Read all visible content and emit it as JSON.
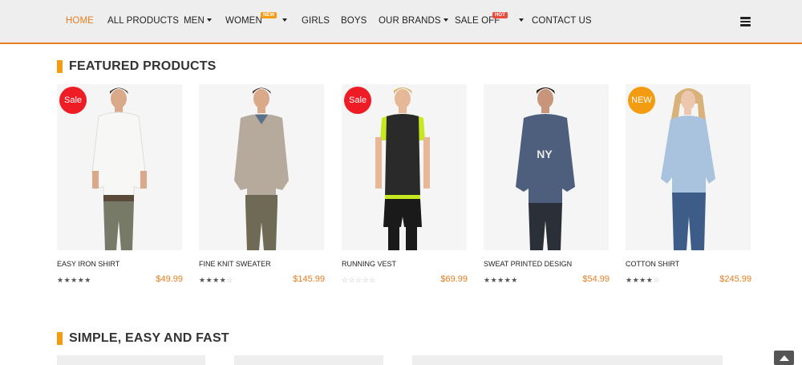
{
  "nav": {
    "items": [
      {
        "label": "HOME"
      },
      {
        "label": "ALL PRODUCTS"
      },
      {
        "label": "MEN"
      },
      {
        "label": "WOMEN",
        "tag": "NEW"
      },
      {
        "label": "GIRLS"
      },
      {
        "label": "BOYS"
      },
      {
        "label": "OUR BRANDS"
      },
      {
        "label": "SALE OFF",
        "tag": "HOT"
      },
      {
        "label": "CONTACT US"
      }
    ],
    "accent_color": "#e67e22"
  },
  "featured": {
    "title": "FEATURED PRODUCTS",
    "products": [
      {
        "name": "EASY IRON SHIRT",
        "price": "$49.99",
        "badge": "Sale",
        "rating": 5
      },
      {
        "name": "FINE KNIT SWEATER",
        "price": "$145.99",
        "badge": "",
        "rating": 4
      },
      {
        "name": "RUNNING VEST",
        "price": "$69.99",
        "badge": "Sale",
        "rating": 0
      },
      {
        "name": "SWEAT PRINTED DESIGN",
        "price": "$54.99",
        "badge": "",
        "rating": 5
      },
      {
        "name": "COTTON SHIRT",
        "price": "$245.99",
        "badge": "NEW",
        "rating": 4
      }
    ],
    "sweatshirt_print": "NY"
  },
  "section2": {
    "title": "SIMPLE, EASY AND FAST"
  }
}
